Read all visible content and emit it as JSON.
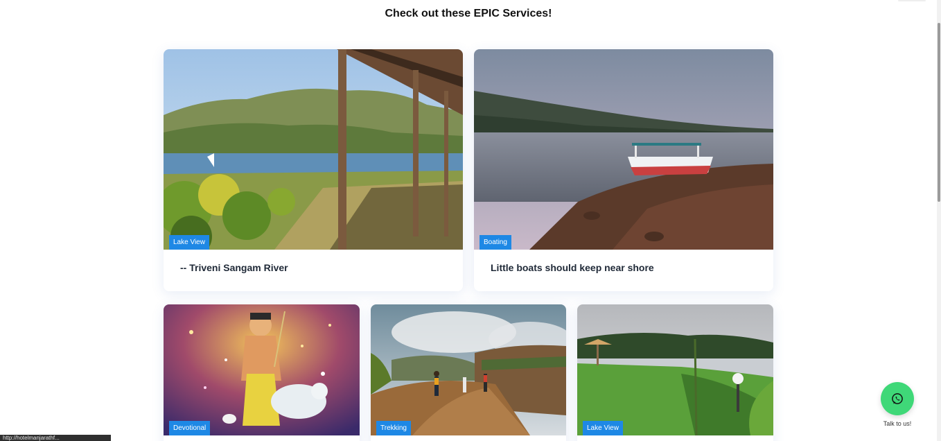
{
  "section": {
    "heading": "Check out these EPIC Services!"
  },
  "cards": [
    {
      "badge": "Lake View",
      "caption": "-- Triveni Sangam River"
    },
    {
      "badge": "Boating",
      "caption": "Little boats should keep near shore"
    },
    {
      "badge": "Devotional",
      "caption": ""
    },
    {
      "badge": "Trekking",
      "caption": ""
    },
    {
      "badge": "Lake View",
      "caption": ""
    }
  ],
  "whatsapp": {
    "label": "Talk to us!",
    "icon": "whatsapp-icon",
    "color": "#3fd878"
  },
  "status_bar": {
    "url": "http://hotelmanjarathf..."
  },
  "colors": {
    "badge": "#1e88e5",
    "heading": "#111111"
  }
}
